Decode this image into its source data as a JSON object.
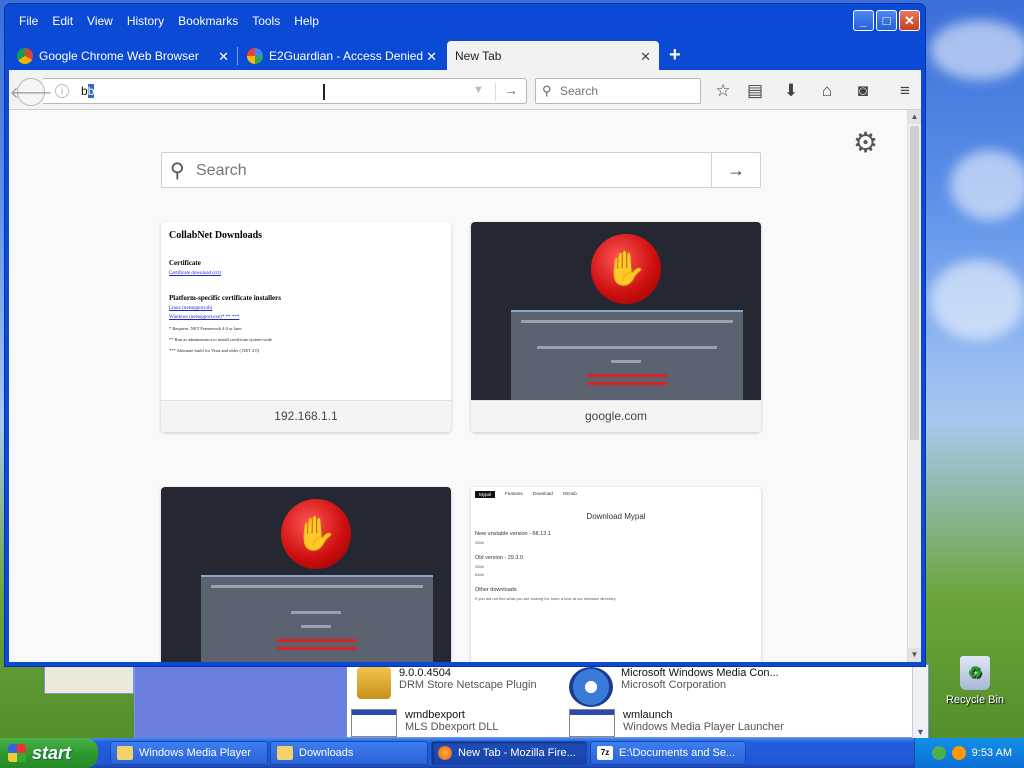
{
  "firefox": {
    "menu": [
      "File",
      "Edit",
      "View",
      "History",
      "Bookmarks",
      "Tools",
      "Help"
    ],
    "tabs": [
      {
        "label": "Google Chrome Web Browser",
        "icon": "chrome-icon"
      },
      {
        "label": "E2Guardian - Access Denied",
        "icon": "google-icon"
      },
      {
        "label": "New Tab",
        "icon": ""
      }
    ],
    "url": {
      "typed": "b",
      "selected": "b"
    },
    "search_placeholder": "Search",
    "newtab": {
      "search_placeholder": "Search",
      "tiles": [
        {
          "label": "192.168.1.1"
        },
        {
          "label": "google.com"
        }
      ],
      "collab": {
        "title": "CollabNet Downloads",
        "h1": "Certificate",
        "l1": "Certificate download (crt)",
        "h2": "Platform-specific certificate installers",
        "l2": "Linux (netsupport.sh)",
        "l3": "Windows (netsupport.exe)* ** ***",
        "n1": "* Requires .NET Framework 4.0 or later",
        "n2": "** Run as administrator to install certificate system-wide",
        "n3": "*** Alternate build for Vista and older (.NET 2.0)"
      },
      "mypal": {
        "nav": [
          "Mypal",
          "Features",
          "Download",
          "GitHub"
        ],
        "title": "Download Mypal",
        "new_ver": "New unstable version - 68.13.1",
        "new_sub": "32bit",
        "old_ver": "Old version - 29.3.0",
        "old_sub1": "32bit",
        "old_sub2": "64bit",
        "other": "Other downloads",
        "other_note": "If you did not find what you are looking for, have a look at our releases directory."
      }
    }
  },
  "background_window": {
    "items": [
      {
        "line1": "9.0.0.4504",
        "line2": "DRM Store Netscape Plugin"
      },
      {
        "line1": "Microsoft Windows Media Con...",
        "line2": "Microsoft Corporation"
      },
      {
        "line1": "wmdbexport",
        "line2": "MLS Dbexport DLL"
      },
      {
        "line1": "wmlaunch",
        "line2": "Windows Media Player Launcher"
      }
    ]
  },
  "desktop": {
    "recycle_bin": "Recycle Bin"
  },
  "taskbar": {
    "start": "start",
    "tasks": [
      {
        "label": "Windows Media Player"
      },
      {
        "label": "Downloads"
      },
      {
        "label": "New Tab - Mozilla Fire..."
      },
      {
        "label": "E:\\Documents and Se..."
      }
    ],
    "clock": "9:53 AM"
  }
}
